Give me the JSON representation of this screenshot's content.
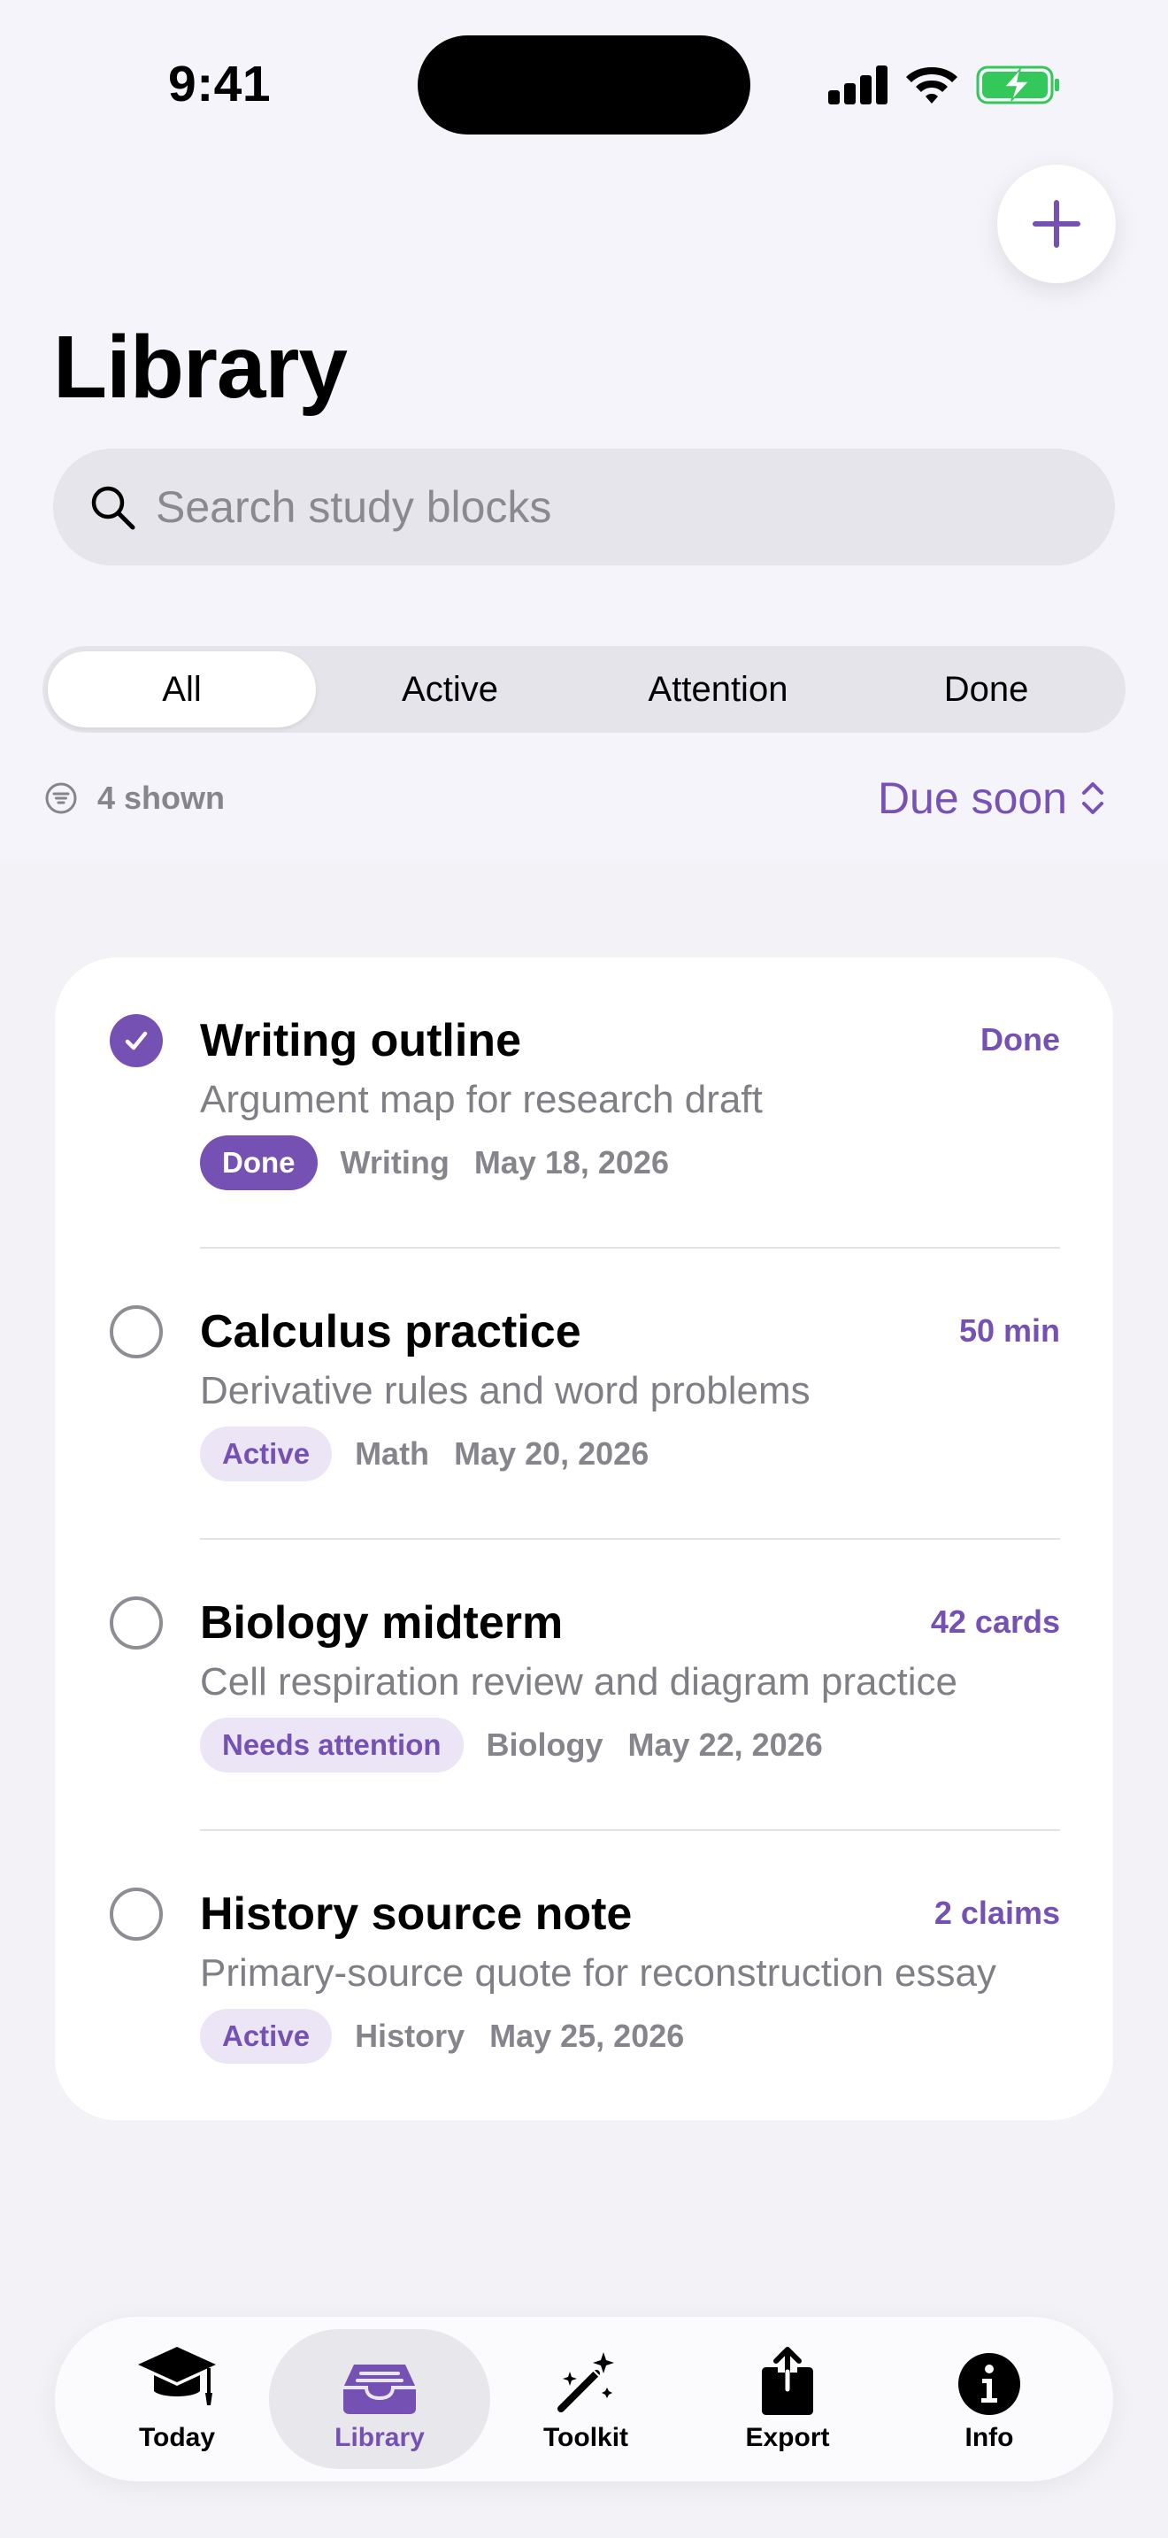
{
  "status_bar": {
    "time": "9:41"
  },
  "header": {
    "title": "Library"
  },
  "search": {
    "placeholder": "Search study blocks"
  },
  "filters": {
    "segments": [
      "All",
      "Active",
      "Attention",
      "Done"
    ],
    "selected": "All"
  },
  "list_meta": {
    "shown_count": "4 shown",
    "sort_label": "Due soon"
  },
  "items": [
    {
      "title": "Writing outline",
      "description": "Argument map for research draft",
      "metric": "Done",
      "status": "Done",
      "subject": "Writing",
      "date": "May 18, 2026",
      "checked": true
    },
    {
      "title": "Calculus practice",
      "description": "Derivative rules and word problems",
      "metric": "50 min",
      "status": "Active",
      "subject": "Math",
      "date": "May 20, 2026",
      "checked": false
    },
    {
      "title": "Biology midterm",
      "description": "Cell respiration review and diagram practice",
      "metric": "42 cards",
      "status": "Needs attention",
      "subject": "Biology",
      "date": "May 22, 2026",
      "checked": false
    },
    {
      "title": "History source note",
      "description": "Primary-source quote for reconstruction essay",
      "metric": "2 claims",
      "status": "Active",
      "subject": "History",
      "date": "May 25, 2026",
      "checked": false
    }
  ],
  "tabbar": {
    "tabs": [
      {
        "label": "Today",
        "icon": "graduation-cap-icon"
      },
      {
        "label": "Library",
        "icon": "tray-icon"
      },
      {
        "label": "Toolkit",
        "icon": "magic-wand-icon"
      },
      {
        "label": "Export",
        "icon": "share-icon"
      },
      {
        "label": "Info",
        "icon": "info-icon"
      }
    ],
    "selected": "Library"
  },
  "colors": {
    "accent": "#7551b3",
    "background": "#f2f2f7",
    "battery": "#34c759"
  }
}
